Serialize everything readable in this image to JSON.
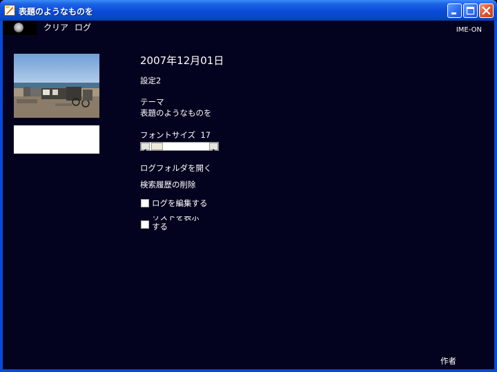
{
  "window": {
    "title": "表題のようなものを",
    "buttons": [
      "minimize",
      "maximize",
      "close"
    ]
  },
  "menu": {
    "items": [
      "クリア",
      "ログ"
    ],
    "ime_status": "IME-ON"
  },
  "main": {
    "date": "2007年12月01日",
    "setting": "設定2",
    "theme_label": "テーマ",
    "theme_value": "表題のようなものを",
    "font_size_label": "フォントサイズ",
    "font_size_value": "17",
    "open_log_folder": "ログフォルダを開く",
    "delete_search_history": "検索履歴の削除",
    "checkbox_edit_log": {
      "label": "ログを編集する",
      "checked": false
    },
    "checkbox_show_list": {
      "label_line1": "リストを表示",
      "label_line2": "する",
      "checked": false
    }
  },
  "footer": {
    "author": "作者"
  },
  "icons": [
    "app-icon",
    "minimize-icon",
    "maximize-icon",
    "close-icon",
    "disc-icon"
  ],
  "colors": {
    "titlebar": "#0a4ad8",
    "client_background": "#03031f",
    "text": "#ffffff"
  }
}
